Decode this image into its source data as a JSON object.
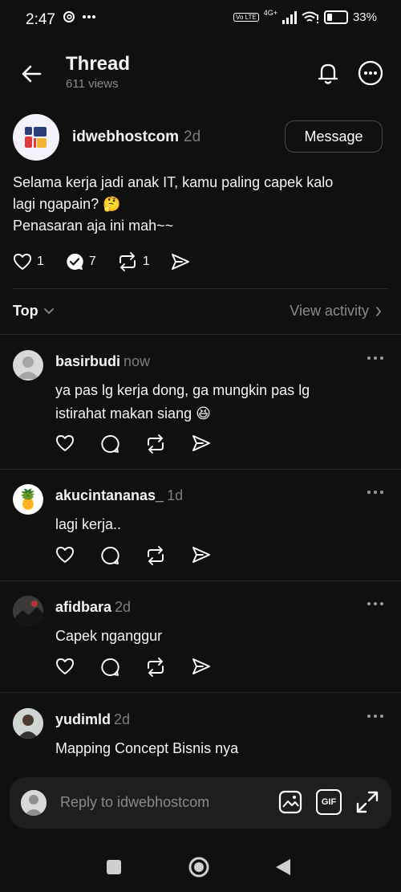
{
  "status": {
    "time": "2:47",
    "network": "4G+",
    "volte": "Vo LTE",
    "battery": "33%"
  },
  "header": {
    "title": "Thread",
    "views": "611 views"
  },
  "post": {
    "author": "idwebhostcom",
    "time": "2d",
    "message_button": "Message",
    "line1": "Selama kerja jadi anak IT, kamu paling capek kalo",
    "line2": "lagi ngapain? 🤔",
    "line3": "Penasaran aja ini mah~~",
    "likes": "1",
    "replies": "7",
    "reposts": "1"
  },
  "sort": {
    "label": "Top",
    "view_activity": "View activity"
  },
  "replies": [
    {
      "user": "basirbudi",
      "time": "now",
      "line1": "ya pas lg kerja dong, ga mungkin pas lg",
      "line2": "istirahat makan siang 😆"
    },
    {
      "user": "akucintananas_",
      "time": "1d",
      "line1": "lagi kerja..",
      "avatar_emoji": "🍍"
    },
    {
      "user": "afidbara",
      "time": "2d",
      "line1": "Capek nganggur"
    },
    {
      "user": "yudimld",
      "time": "2d",
      "line1": "Mapping Concept Bisnis nya"
    }
  ],
  "composer": {
    "placeholder": "Reply to idwebhostcom",
    "gif_label": "GIF"
  },
  "colors": {
    "background": "#101010",
    "text": "#f3f3f3",
    "muted": "#8a8a8a",
    "logo_blue": "#2c3e7a",
    "logo_red": "#e03b3b",
    "logo_yellow": "#f2b531"
  }
}
